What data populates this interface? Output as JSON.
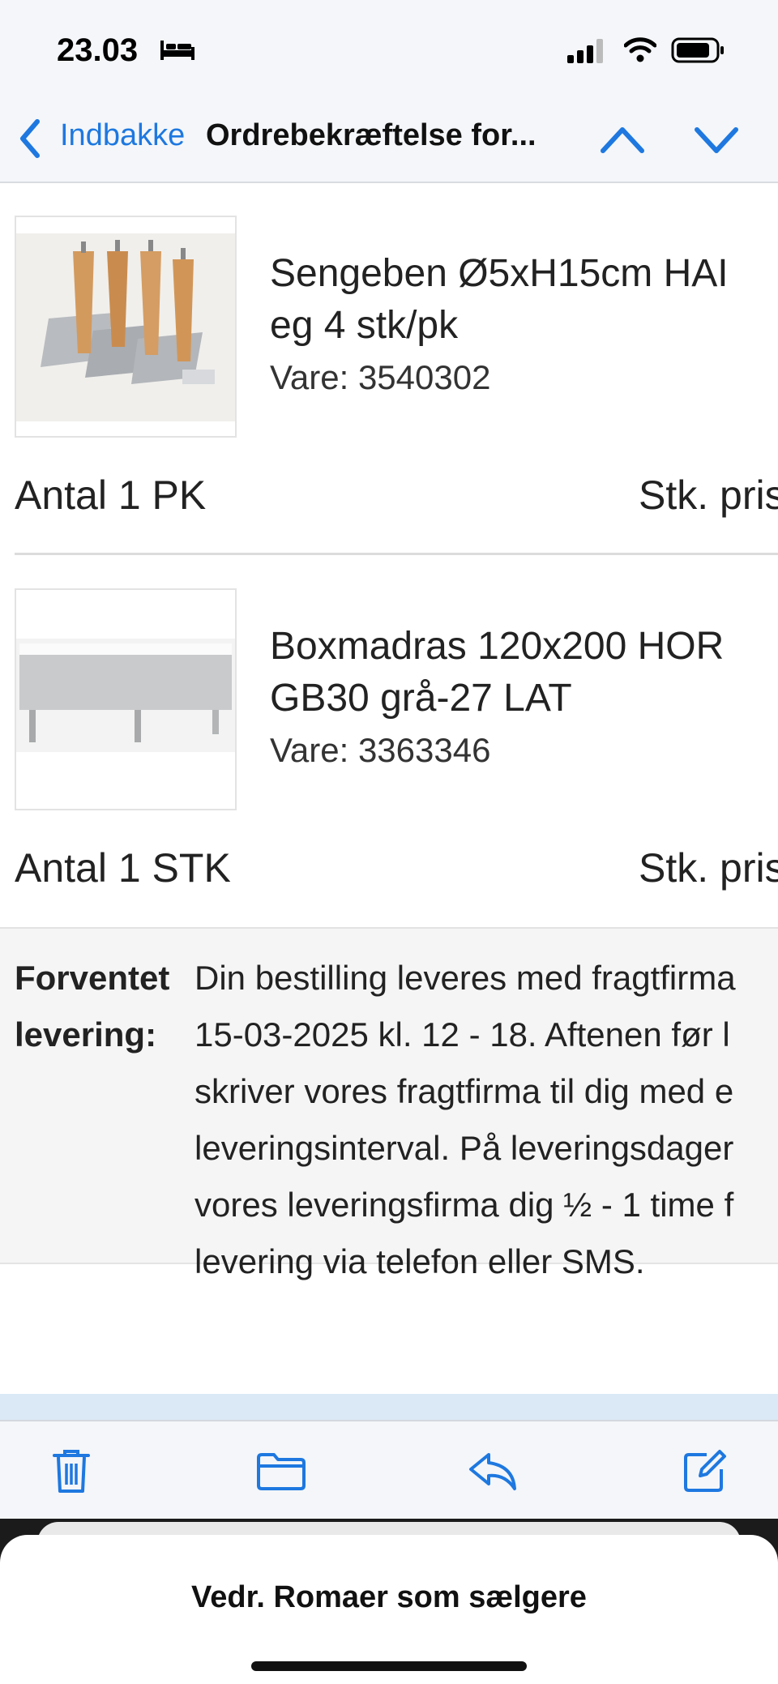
{
  "status_bar": {
    "time": "23.03"
  },
  "nav": {
    "back_label": "Indbakke",
    "title": "Ordrebekræftelse for..."
  },
  "products": [
    {
      "name_line1": "Sengeben Ø5xH15cm HAI",
      "name_line2": "eg 4 stk/pk",
      "sku": "Vare: 3540302",
      "quantity": "Antal 1 PK",
      "unit_price_label": "Stk. pris"
    },
    {
      "name_line1": "Boxmadras 120x200 HOR",
      "name_line2": "GB30 grå-27 LAT",
      "sku": "Vare: 3363346",
      "quantity": "Antal 1 STK",
      "unit_price_label": "Stk. pris"
    }
  ],
  "delivery": {
    "label_line1": "Forventet",
    "label_line2": "levering:",
    "text": "Din bestilling leveres med fragtfirma\n15-03-2025 kl. 12 - 18. Aftenen før l\nskriver vores fragtfirma til dig med e\nleveringsinterval. På leveringsdager\nvores leveringsfirma dig ½ - 1 time f\nlevering via telefon eller SMS."
  },
  "toolbar": {
    "icons": [
      "trash-icon",
      "folder-icon",
      "reply-icon",
      "compose-icon"
    ]
  },
  "sheet": {
    "title": "Vedr. Romaer som sælgere"
  },
  "colors": {
    "accent": "#1e78e0",
    "bar_bg": "#f4f6f9"
  }
}
